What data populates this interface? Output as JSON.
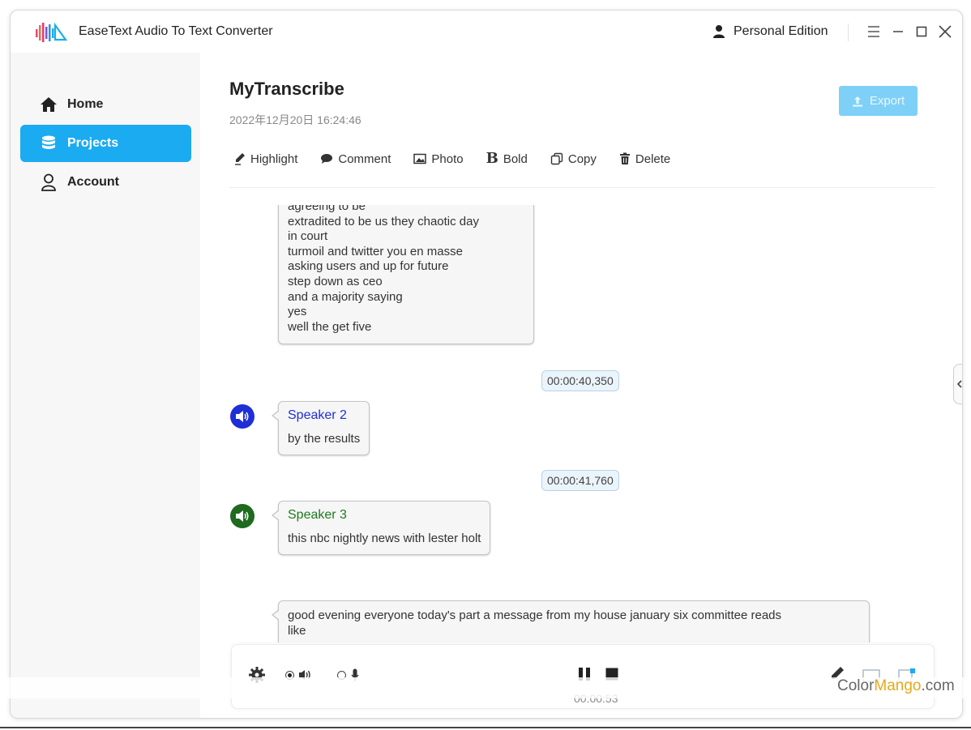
{
  "window": {
    "app_title": "EaseText Audio To Text Converter",
    "edition": "Personal Edition"
  },
  "sidebar": {
    "items": [
      {
        "label": "Home",
        "icon": "home-icon",
        "active": false
      },
      {
        "label": "Projects",
        "icon": "database-icon",
        "active": true
      },
      {
        "label": "Account",
        "icon": "user-icon",
        "active": false
      }
    ]
  },
  "project": {
    "title": "MyTranscribe",
    "date": "2022年12月20日 16:24:46"
  },
  "export_label": "Export",
  "toolbar": {
    "highlight": "Highlight",
    "comment": "Comment",
    "photo": "Photo",
    "bold": "Bold",
    "copy": "Copy",
    "delete": "Delete"
  },
  "transcript": {
    "first_block_lines": [
      "agreeing to be",
      "extradited to be us they chaotic day",
      "in court",
      "turmoil and twitter you en masse",
      "asking users and up for future",
      "step down as ceo",
      "and a majority saying",
      "yes",
      "well the get five"
    ],
    "timestamp_1": "00:00:40,350",
    "speaker_2": {
      "name": "Speaker 2",
      "text": "by the results",
      "color": "#1f2fd6"
    },
    "timestamp_2": "00:00:41,760",
    "speaker_3": {
      "name": "Speaker 3",
      "text": "this nbc nightly news with lester holt",
      "color": "#1e7a1e"
    },
    "last_block_lines": [
      "good evening everyone today's part a message from my house january six committee reads",
      "like"
    ]
  },
  "player": {
    "elapsed": "00:00:53"
  },
  "watermark": {
    "part1": "Color",
    "part2": "Mango",
    "part3": ".com"
  },
  "colors": {
    "accent": "#1aabf1",
    "export_disabled": "#7fd0f7"
  }
}
